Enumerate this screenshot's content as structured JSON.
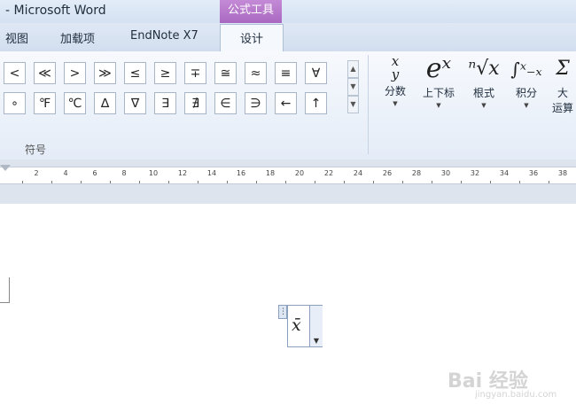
{
  "title": "- Microsoft Word",
  "context_tab_header": "公式工具",
  "tabs": [
    "视图",
    "加载项",
    "EndNote X7"
  ],
  "active_tab": "设计",
  "symbols_row1": [
    "<",
    "≪",
    ">",
    "≫",
    "≤",
    "≥",
    "∓",
    "≅",
    "≈",
    "≡",
    "∀"
  ],
  "symbols_row2": [
    "∘",
    "℉",
    "℃",
    "∆",
    "∇",
    "∃",
    "∄",
    "∈",
    "∋",
    "←",
    "↑"
  ],
  "symbols_group_label": "符号",
  "structures": [
    {
      "icon": "x/y",
      "label": "分数"
    },
    {
      "icon": "eˣ",
      "label": "上下标"
    },
    {
      "icon": "ⁿ√x",
      "label": "根式"
    },
    {
      "icon": "∫ˣ₋ₓ",
      "label": "积分"
    },
    {
      "icon": "Σ",
      "label": "大型运算符",
      "label_line1": "大",
      "label_line2": "运算"
    }
  ],
  "ruler_numbers": [
    "2",
    "4",
    "6",
    "8",
    "10",
    "12",
    "14",
    "16",
    "18",
    "20",
    "22",
    "24",
    "26",
    "28",
    "30",
    "32",
    "34",
    "36",
    "38"
  ],
  "equation": "x̄",
  "watermark": "Bai 经验",
  "watermark_url": "jingyan.baidu.com",
  "colors": {
    "context_tab": "#a868c0",
    "ribbon_bg": "#eef3fa"
  }
}
